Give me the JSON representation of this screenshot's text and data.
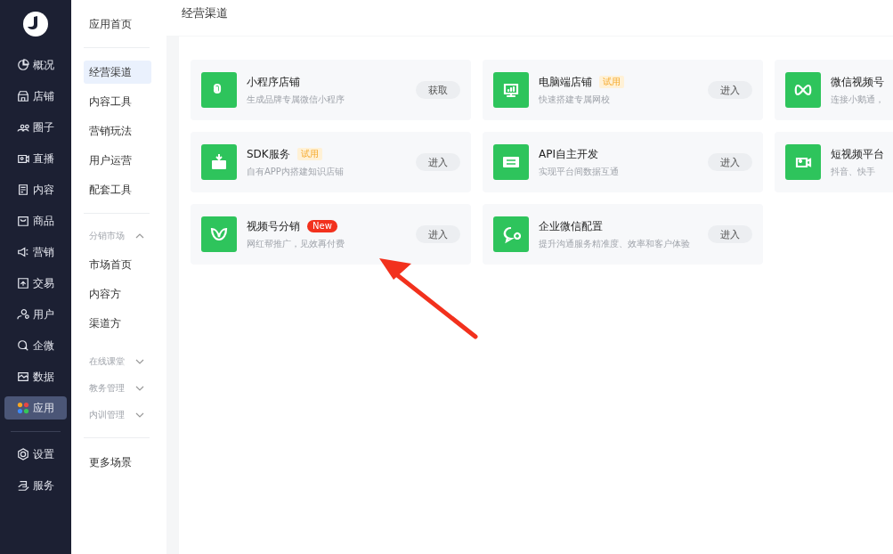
{
  "nav": [
    {
      "label": "概况",
      "selected": false
    },
    {
      "label": "店铺",
      "selected": false
    },
    {
      "label": "圈子",
      "selected": false
    },
    {
      "label": "直播",
      "selected": false
    },
    {
      "label": "内容",
      "selected": false
    },
    {
      "label": "商品",
      "selected": false
    },
    {
      "label": "营销",
      "selected": false
    },
    {
      "label": "交易",
      "selected": false
    },
    {
      "label": "用户",
      "selected": false
    },
    {
      "label": "企微",
      "selected": false
    },
    {
      "label": "数据",
      "selected": false
    },
    {
      "label": "应用",
      "selected": true
    }
  ],
  "nav_bottom": [
    {
      "label": "设置",
      "selected": false
    },
    {
      "label": "服务",
      "selected": false
    }
  ],
  "submenu": [
    {
      "kind": "link",
      "label": "应用首页",
      "selected": false
    },
    {
      "kind": "divider"
    },
    {
      "kind": "link",
      "label": "经营渠道",
      "selected": true
    },
    {
      "kind": "link",
      "label": "内容工具",
      "selected": false
    },
    {
      "kind": "link",
      "label": "营销玩法",
      "selected": false
    },
    {
      "kind": "link",
      "label": "用户运营",
      "selected": false
    },
    {
      "kind": "link",
      "label": "配套工具",
      "selected": false
    },
    {
      "kind": "divider"
    },
    {
      "kind": "group",
      "label": "分销市场",
      "expanded": true,
      "children": [
        {
          "label": "市场首页",
          "selected": false
        },
        {
          "label": "内容方",
          "selected": false
        },
        {
          "label": "渠道方",
          "selected": false
        }
      ]
    },
    {
      "kind": "group",
      "label": "在线课堂",
      "expanded": false
    },
    {
      "kind": "group",
      "label": "教务管理",
      "expanded": false
    },
    {
      "kind": "group",
      "label": "内训管理",
      "expanded": false
    },
    {
      "kind": "divider"
    },
    {
      "kind": "link",
      "label": "更多场景",
      "selected": false
    }
  ],
  "page_title": "经营渠道",
  "cards": [
    {
      "title": "小程序店铺",
      "description": "生成品牌专属微信小程序",
      "button": "获取"
    },
    {
      "title": "电脑端店铺",
      "badge": {
        "kind": "trial",
        "text": "试用"
      },
      "description": "快速搭建专属网校",
      "button": "进入"
    },
    {
      "title": "微信视频号",
      "description": "连接小鹅通，"
    },
    {
      "title": "SDK服务",
      "badge": {
        "kind": "trial",
        "text": "试用"
      },
      "description": "自有APP内搭建知识店铺",
      "button": "进入"
    },
    {
      "title": "API自主开发",
      "description": "实现平台间数据互通",
      "button": "进入"
    },
    {
      "title": "短视频平台",
      "description": "抖音、快手"
    },
    {
      "title": "视频号分销",
      "badge": {
        "kind": "new",
        "text": "New"
      },
      "description": "网红帮推广，见效再付费",
      "button": "进入"
    },
    {
      "title": "企业微信配置",
      "description": "提升沟通服务精准度、效率和客户体验",
      "button": "进入"
    }
  ]
}
